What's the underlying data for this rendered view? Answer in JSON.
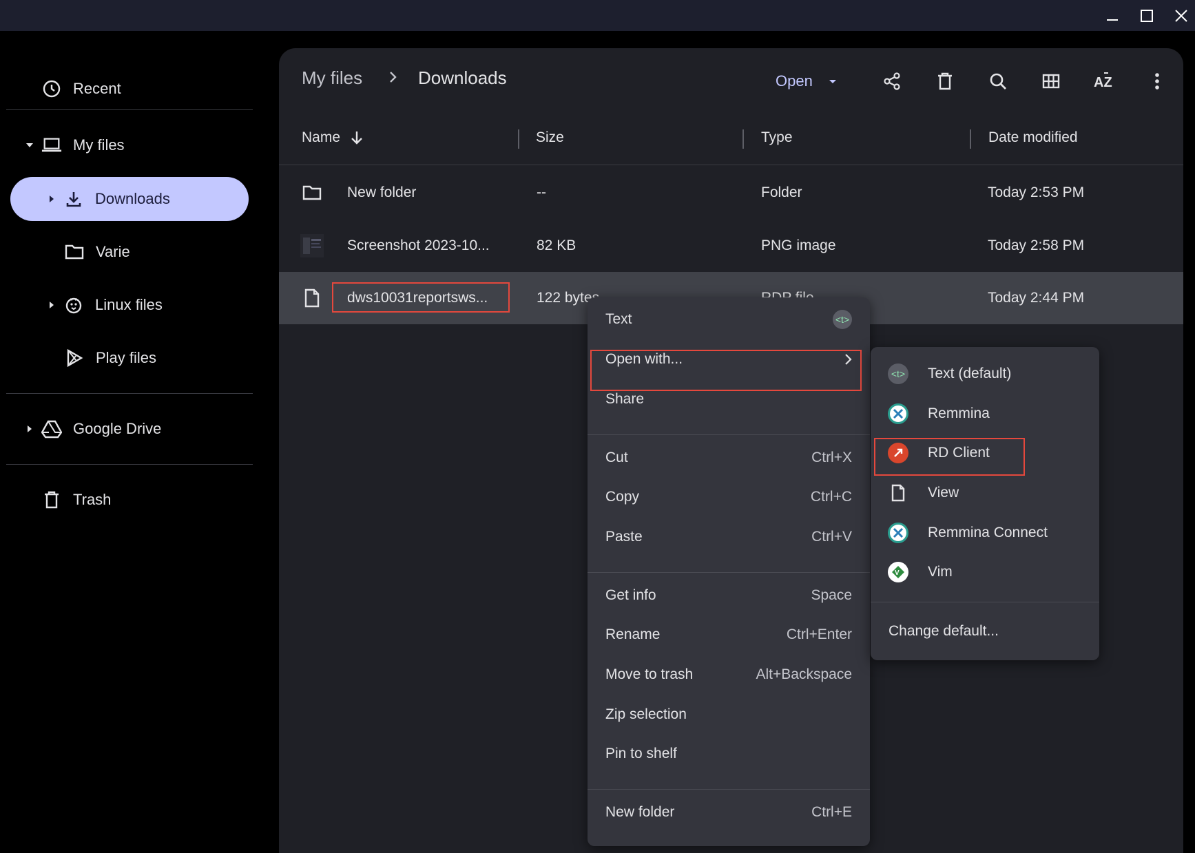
{
  "titlebar": {
    "minimize": "minimize",
    "maximize": "maximize",
    "close": "close"
  },
  "sidebar": {
    "recent": "Recent",
    "my_files": "My files",
    "downloads": "Downloads",
    "varie": "Varie",
    "linux_files": "Linux files",
    "play_files": "Play files",
    "google_drive": "Google Drive",
    "trash": "Trash"
  },
  "breadcrumb": {
    "root": "My files",
    "separator": ">",
    "current": "Downloads"
  },
  "toolbar": {
    "open_label": "Open"
  },
  "columns": {
    "name": "Name",
    "size": "Size",
    "type": "Type",
    "date": "Date modified"
  },
  "files": [
    {
      "name": "New folder",
      "size": "--",
      "type": "Folder",
      "date": "Today 2:53 PM"
    },
    {
      "name": "Screenshot 2023-10...",
      "size": "82 KB",
      "type": "PNG image",
      "date": "Today 2:58 PM"
    },
    {
      "name": "dws10031reportsws...",
      "size": "122 bytes",
      "type": "RDP file",
      "date": "Today 2:44 PM"
    }
  ],
  "context_menu": {
    "text": "Text",
    "open_with": "Open with...",
    "share": "Share",
    "cut": "Cut",
    "cut_sc": "Ctrl+X",
    "copy": "Copy",
    "copy_sc": "Ctrl+C",
    "paste": "Paste",
    "paste_sc": "Ctrl+V",
    "get_info": "Get info",
    "get_info_sc": "Space",
    "rename": "Rename",
    "rename_sc": "Ctrl+Enter",
    "move_to_trash": "Move to trash",
    "move_to_trash_sc": "Alt+Backspace",
    "zip": "Zip selection",
    "pin": "Pin to shelf",
    "new_folder": "New folder",
    "new_folder_sc": "Ctrl+E"
  },
  "open_with_menu": {
    "text_default": "Text (default)",
    "remmina": "Remmina",
    "rd_client": "RD Client",
    "view": "View",
    "remmina_connect": "Remmina Connect",
    "vim": "Vim",
    "change_default": "Change default..."
  },
  "colors": {
    "accent": "#c3c8ff",
    "highlight_box": "#e5483d",
    "panel": "#1f2026",
    "menu": "#34353d"
  }
}
